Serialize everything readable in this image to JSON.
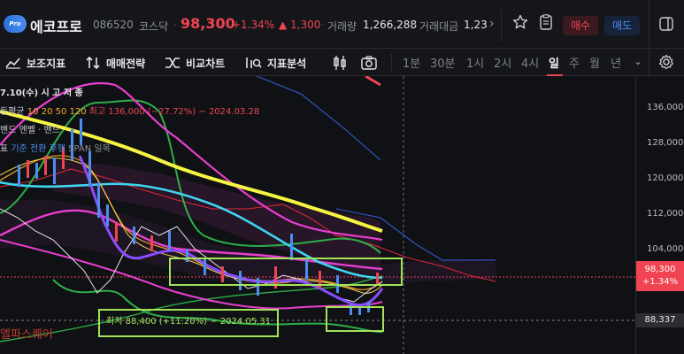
{
  "header": {
    "stock_name": "에코프로",
    "code": "086520",
    "market": "코스닥",
    "price": "98,300",
    "change_pct": "+1.34%",
    "change_abs": "▲ 1,300",
    "volume_label": "거래량",
    "volume_value": "1,266,288",
    "amount_label": "거래대금",
    "amount_value": "1,23",
    "buy_label": "매수",
    "sell_label": "매도",
    "logo_text": "Pro"
  },
  "toolbar": {
    "aux_indicator": "보조지표",
    "trade_strategy": "매매전략",
    "compare_chart": "비교차트",
    "indicator_analysis": "지표분석",
    "timeframes": [
      "1분",
      "30분",
      "1시",
      "2시",
      "4시",
      "일",
      "주",
      "월",
      "년"
    ],
    "active_timeframe": "일"
  },
  "chart": {
    "legend": {
      "line1": "7.10(수)  시  고  저  종",
      "line2_label": "동평균",
      "line2_values": "10  20  50  120",
      "high_note": "최고 136,000 (−27.72%) − 2024.03.28",
      "line3": "밴드  엔벨 · 밴드",
      "line4_prefix": "표",
      "line4_items": "기준  전환  후행",
      "line4_suffix": "SPAN 일목"
    },
    "y_ticks": [
      "136,000",
      "128,000",
      "120,000",
      "112,000",
      "104,000"
    ],
    "current_price": "98,300",
    "current_change": "+1.34%",
    "low_value": "88,337",
    "low_note": "최저 88,400 (+11.20%) − 2024.05.31",
    "watermark": "엘파스퀘어",
    "colors": {
      "up": "#f04452",
      "down": "#4b8df0",
      "ma_yellow": "#f5f542",
      "ma_cyan": "#3fd4f0",
      "ma_magenta": "#e83fd0",
      "bollinger": "#2fae4a",
      "highlight_box": "#a3e35a"
    }
  }
}
